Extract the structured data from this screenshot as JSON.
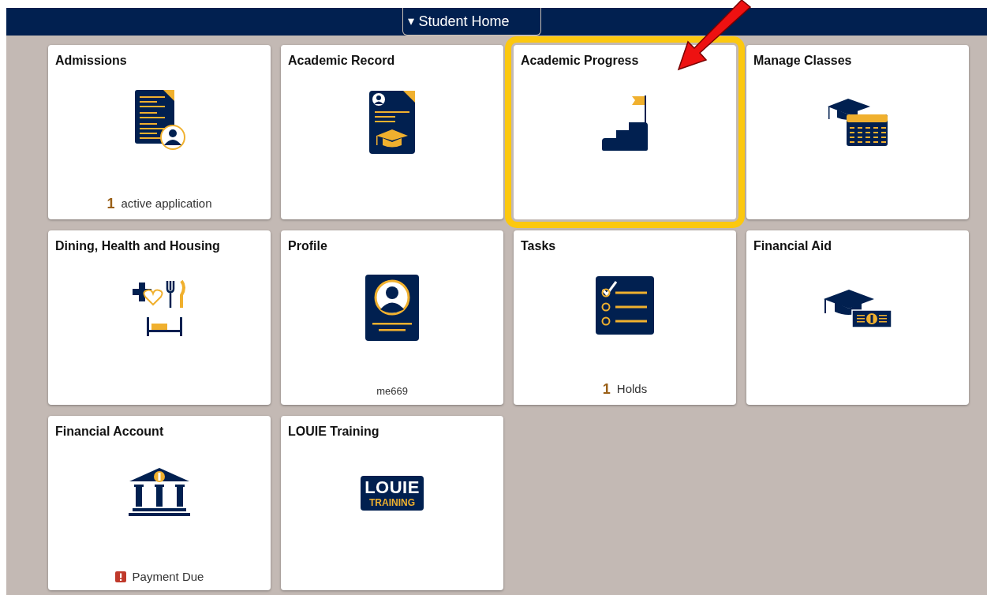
{
  "header": {
    "menu_caret": "▾",
    "title": "Student Home"
  },
  "tiles": [
    {
      "title": "Admissions",
      "highlighted": false,
      "footer": {
        "kind": "count",
        "count": "1",
        "label": "active application"
      }
    },
    {
      "title": "Academic Record",
      "highlighted": false
    },
    {
      "title": "Academic Progress",
      "highlighted": true
    },
    {
      "title": "Manage Classes",
      "highlighted": false
    },
    {
      "title": "Dining, Health and Housing",
      "highlighted": false
    },
    {
      "title": "Profile",
      "highlighted": false,
      "footer": {
        "kind": "text",
        "label": "me669"
      }
    },
    {
      "title": "Tasks",
      "highlighted": false,
      "footer": {
        "kind": "count",
        "count": "1",
        "label": "Holds"
      }
    },
    {
      "title": "Financial Aid",
      "highlighted": false
    },
    {
      "title": "Financial Account",
      "highlighted": false,
      "footer": {
        "kind": "alert",
        "label": "Payment Due"
      }
    },
    {
      "title": "LOUIE Training",
      "highlighted": false,
      "logo": {
        "line_1": "LOUIE",
        "line_2": "TRAINING"
      }
    }
  ]
}
